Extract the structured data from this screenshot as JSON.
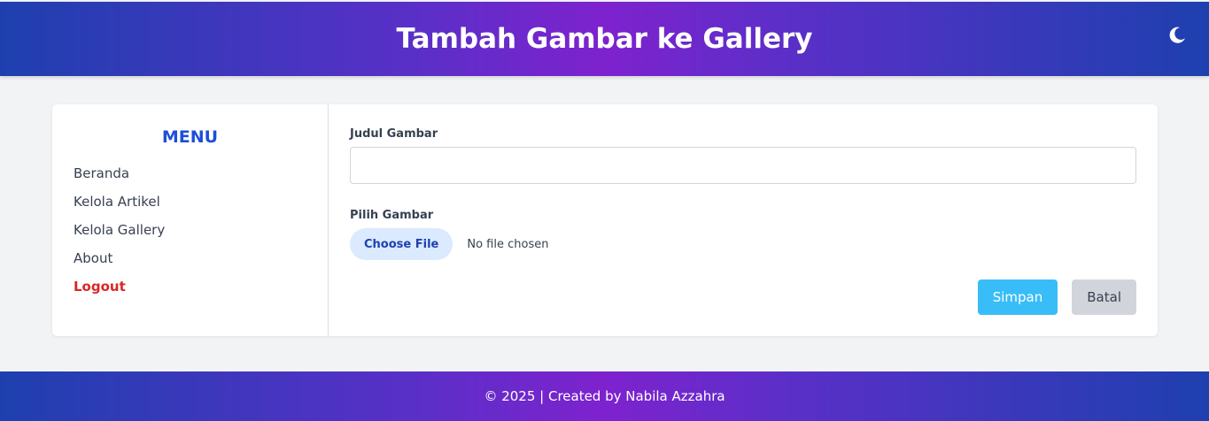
{
  "header": {
    "title": "Tambah Gambar ke Gallery",
    "theme_toggle_icon": "moon-icon"
  },
  "sidebar": {
    "title": "MENU",
    "items": [
      {
        "label": "Beranda"
      },
      {
        "label": "Kelola Artikel"
      },
      {
        "label": "Kelola Gallery"
      },
      {
        "label": "About"
      },
      {
        "label": "Logout"
      }
    ]
  },
  "form": {
    "title_label": "Judul Gambar",
    "title_value": "",
    "title_placeholder": "",
    "image_label": "Pilih Gambar",
    "choose_file_label": "Choose File",
    "no_file_text": "No file chosen",
    "save_label": "Simpan",
    "cancel_label": "Batal"
  },
  "footer": {
    "text": "© 2025 | Created by Nabila Azzahra"
  },
  "colors": {
    "brand_blue": "#1e40af",
    "brand_purple": "#7e22ce",
    "menu_title": "#1d4ed8",
    "logout": "#dc2626",
    "save": "#38bdf8",
    "cancel": "#d1d5db"
  }
}
